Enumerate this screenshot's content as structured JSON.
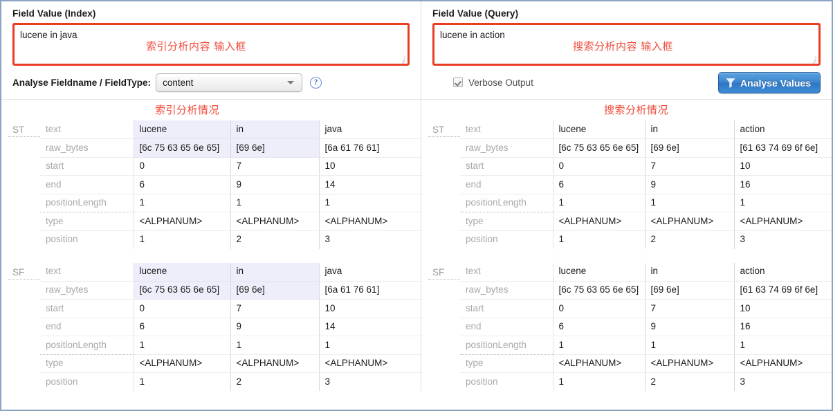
{
  "panels": {
    "index": {
      "field_label": "Field Value (Index)",
      "field_value": "lucene in java",
      "field_annotation": "索引分析内容 输入框",
      "section_annotation": "索引分析情况",
      "toolbar": {
        "fieldname_label": "Analyse Fieldname / FieldType:",
        "fieldname_value": "content",
        "help_icon": "?"
      },
      "blocks": [
        {
          "tag": "ST",
          "rows": [
            {
              "key": "text",
              "values": [
                "lucene",
                "in",
                "java"
              ]
            },
            {
              "key": "raw_bytes",
              "values": [
                "[6c 75 63 65 6e 65]",
                "[69 6e]",
                "[6a 61 76 61]"
              ]
            },
            {
              "key": "start",
              "values": [
                "0",
                "7",
                "10"
              ]
            },
            {
              "key": "end",
              "values": [
                "6",
                "9",
                "14"
              ]
            },
            {
              "key": "positionLength",
              "values": [
                "1",
                "1",
                "1"
              ]
            },
            {
              "key": "type",
              "values": [
                "<ALPHANUM>",
                "<ALPHANUM>",
                "<ALPHANUM>"
              ]
            },
            {
              "key": "position",
              "values": [
                "1",
                "2",
                "3"
              ]
            }
          ]
        },
        {
          "tag": "SF",
          "rows": [
            {
              "key": "text",
              "values": [
                "lucene",
                "in",
                "java"
              ]
            },
            {
              "key": "raw_bytes",
              "values": [
                "[6c 75 63 65 6e 65]",
                "[69 6e]",
                "[6a 61 76 61]"
              ]
            },
            {
              "key": "start",
              "values": [
                "0",
                "7",
                "10"
              ]
            },
            {
              "key": "end",
              "values": [
                "6",
                "9",
                "14"
              ]
            },
            {
              "key": "positionLength",
              "values": [
                "1",
                "1",
                "1"
              ]
            },
            {
              "key": "type",
              "values": [
                "<ALPHANUM>",
                "<ALPHANUM>",
                "<ALPHANUM>"
              ]
            },
            {
              "key": "position",
              "values": [
                "1",
                "2",
                "3"
              ]
            }
          ]
        }
      ]
    },
    "query": {
      "field_label": "Field Value (Query)",
      "field_value": "lucene in action",
      "field_annotation": "搜索分析内容 输入框",
      "section_annotation": "搜索分析情况",
      "toolbar": {
        "verbose_label": "Verbose Output",
        "verbose_checked": true,
        "analyse_button_label": "Analyse Values"
      },
      "blocks": [
        {
          "tag": "ST",
          "rows": [
            {
              "key": "text",
              "values": [
                "lucene",
                "in",
                "action"
              ]
            },
            {
              "key": "raw_bytes",
              "values": [
                "[6c 75 63 65 6e 65]",
                "[69 6e]",
                "[61 63 74 69 6f 6e]"
              ]
            },
            {
              "key": "start",
              "values": [
                "0",
                "7",
                "10"
              ]
            },
            {
              "key": "end",
              "values": [
                "6",
                "9",
                "16"
              ]
            },
            {
              "key": "positionLength",
              "values": [
                "1",
                "1",
                "1"
              ]
            },
            {
              "key": "type",
              "values": [
                "<ALPHANUM>",
                "<ALPHANUM>",
                "<ALPHANUM>"
              ]
            },
            {
              "key": "position",
              "values": [
                "1",
                "2",
                "3"
              ]
            }
          ]
        },
        {
          "tag": "SF",
          "rows": [
            {
              "key": "text",
              "values": [
                "lucene",
                "in",
                "action"
              ]
            },
            {
              "key": "raw_bytes",
              "values": [
                "[6c 75 63 65 6e 65]",
                "[69 6e]",
                "[61 63 74 69 6f 6e]"
              ]
            },
            {
              "key": "start",
              "values": [
                "0",
                "7",
                "10"
              ]
            },
            {
              "key": "end",
              "values": [
                "6",
                "9",
                "16"
              ]
            },
            {
              "key": "positionLength",
              "values": [
                "1",
                "1",
                "1"
              ]
            },
            {
              "key": "type",
              "values": [
                "<ALPHANUM>",
                "<ALPHANUM>",
                "<ALPHANUM>"
              ]
            },
            {
              "key": "position",
              "values": [
                "1",
                "2",
                "3"
              ]
            }
          ]
        }
      ]
    }
  },
  "colors": {
    "annotation_red": "#ef4b3a",
    "textarea_border_red": "#ea3c23",
    "button_blue": "#3b86d0",
    "highlight_lavender": "#eeeefa",
    "frame_border": "#8ba4c4"
  }
}
